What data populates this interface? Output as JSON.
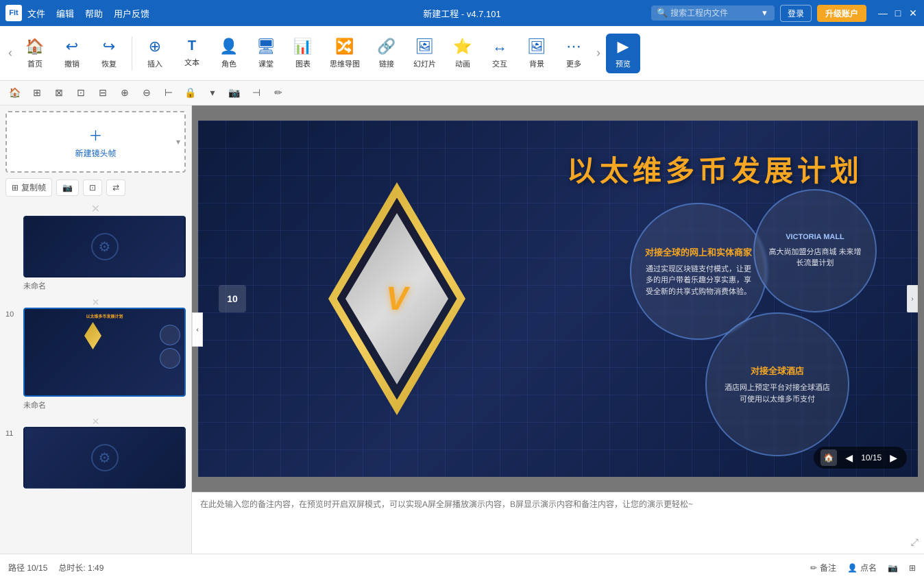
{
  "titlebar": {
    "app_icon": "FIt",
    "menu_items": [
      "文件",
      "编辑",
      "帮助",
      "用户反馈"
    ],
    "center_title": "新建工程 - v4.7.101",
    "search_placeholder": "搜索工程内文件",
    "login_label": "登录",
    "upgrade_label": "升级账户",
    "window_controls": [
      "—",
      "□",
      "×"
    ]
  },
  "toolbar": {
    "items": [
      {
        "id": "home",
        "icon": "🏠",
        "label": "首页"
      },
      {
        "id": "undo",
        "icon": "↩",
        "label": "撤销"
      },
      {
        "id": "redo",
        "icon": "↪",
        "label": "恢复"
      },
      {
        "id": "insert",
        "icon": "＋",
        "label": "插入"
      },
      {
        "id": "text",
        "icon": "T",
        "label": "文本"
      },
      {
        "id": "character",
        "icon": "👤",
        "label": "角色"
      },
      {
        "id": "classroom",
        "icon": "🖥",
        "label": "课堂"
      },
      {
        "id": "chart",
        "icon": "📊",
        "label": "图表"
      },
      {
        "id": "mindmap",
        "icon": "🔀",
        "label": "思维导图"
      },
      {
        "id": "link",
        "icon": "🔗",
        "label": "链接"
      },
      {
        "id": "slide",
        "icon": "▶",
        "label": "幻灯片"
      },
      {
        "id": "animate",
        "icon": "✨",
        "label": "动画"
      },
      {
        "id": "interact",
        "icon": "↔",
        "label": "交互"
      },
      {
        "id": "background",
        "icon": "🖼",
        "label": "背景"
      },
      {
        "id": "more",
        "icon": "⋯",
        "label": "更多"
      },
      {
        "id": "preview",
        "icon": "▶",
        "label": "预览"
      }
    ]
  },
  "action_bar": {
    "buttons": [
      "⊞",
      "⊟",
      "⊠",
      "⊡",
      "⊢",
      "⊣",
      "⊤",
      "⊥",
      "⊦",
      "⊧",
      "📷",
      "🔒",
      "✏"
    ]
  },
  "slide_panel": {
    "new_frame_btn": "新建镜头帧",
    "tools": [
      {
        "icon": "⊞",
        "label": "复制帧"
      },
      {
        "icon": "📷",
        "label": ""
      },
      {
        "icon": "⊡",
        "label": ""
      },
      {
        "icon": "↔",
        "label": ""
      }
    ],
    "slides": [
      {
        "number": "",
        "label": "未命名",
        "active": false
      },
      {
        "number": "10",
        "label": "未命名",
        "active": true
      },
      {
        "number": "11",
        "label": "",
        "active": false
      }
    ]
  },
  "canvas": {
    "slide_title": "以太维多币发展计划",
    "slide_number": "10",
    "circles": [
      {
        "id": "circle1",
        "title": "对接全球的网上和实体商家",
        "text": "通过实现区块链支付模式，让更多的用户带着乐趣分享实惠，享受全新的共享式购物消费体验。"
      },
      {
        "id": "circle2",
        "title": "VICTORIA MALL",
        "text": "高大尚加盟分店商城\n未来增长流量计划"
      },
      {
        "id": "circle3",
        "title": "对接全球酒店",
        "text": "酒店网上预定平台对接全球酒店\n可使用以太维多币支付"
      }
    ],
    "nav": {
      "current": "10",
      "total": "15",
      "display": "10/15"
    }
  },
  "notes": {
    "placeholder": "在此处输入您的备注内容，在预览时开启双屏模式，可以实现A屏全屏播放演示内容，B屏显示演示内容和备注内容，让您的演示更轻松~"
  },
  "statusbar": {
    "path": "路径 10/15",
    "duration": "总时长: 1:49",
    "actions": [
      {
        "icon": "✏",
        "label": "备注"
      },
      {
        "icon": "👤",
        "label": "点名"
      },
      {
        "icon": "📷",
        "label": ""
      },
      {
        "icon": "⊞",
        "label": ""
      }
    ]
  }
}
